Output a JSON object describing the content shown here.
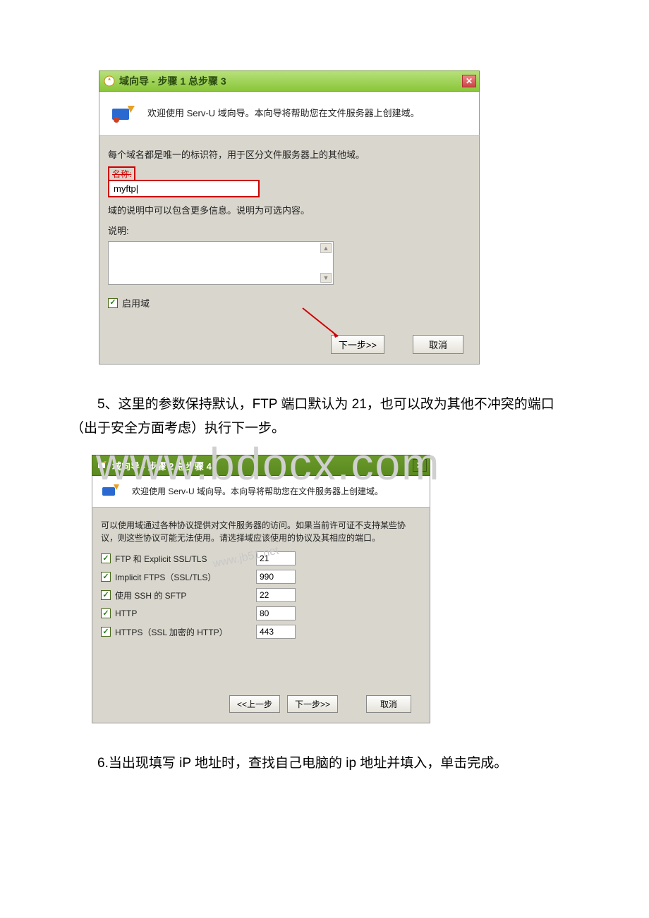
{
  "dialog1": {
    "title": "域向导 - 步骤 1 总步骤 3",
    "banner": "欢迎使用 Serv-U 域向导。本向导将帮助您在文件服务器上创建域。",
    "instr1": "每个域名都是唯一的标识符，用于区分文件服务器上的其他域。",
    "name_label": "名称:",
    "name_value": "myftp|",
    "instr2": "域的说明中可以包含更多信息。说明为可选内容。",
    "desc_label": "说明:",
    "enable_label": "启用域",
    "next_btn": "下一步>>",
    "cancel_btn": "取消"
  },
  "para5": "5、这里的参数保持默认，FTP 端口默认为 21，也可以改为其他不冲突的端口（出于安全方面考虑）执行下一步。",
  "dialog2": {
    "title": "域向导 - 步骤 2 总步骤 4",
    "banner": "欢迎使用 Serv-U 域向导。本向导将帮助您在文件服务器上创建域。",
    "instr": "可以使用域通过各种协议提供对文件服务器的访问。如果当前许可证不支持某些协议，则这些协议可能无法使用。请选择域应该使用的协议及其相应的端口。",
    "protocols": [
      {
        "label": "FTP 和 Explicit SSL/TLS",
        "port": "21"
      },
      {
        "label": "Implicit FTPS（SSL/TLS）",
        "port": "990"
      },
      {
        "label": "使用 SSH 的 SFTP",
        "port": "22"
      },
      {
        "label": "HTTP",
        "port": "80"
      },
      {
        "label": "HTTPS（SSL 加密的 HTTP）",
        "port": "443"
      }
    ],
    "prev_btn": "<<上一步",
    "next_btn": "下一步>>",
    "cancel_btn": "取消"
  },
  "para6": "6.当出现填写 iP 地址时，查找自己电脑的 ip 地址并填入，单击完成。",
  "watermarks": {
    "big": "www.bdocx.com",
    "small": "www.jb51.net"
  }
}
